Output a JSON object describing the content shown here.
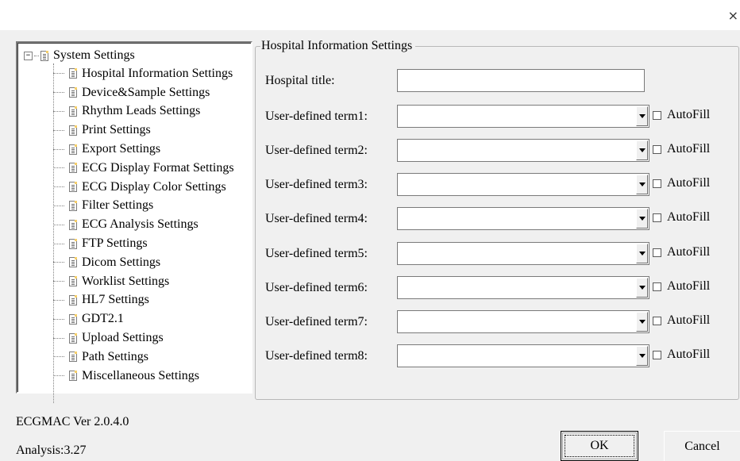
{
  "window": {
    "close_glyph": "×"
  },
  "tree": {
    "root_label": "System Settings",
    "expander_glyph": "−",
    "items": [
      "Hospital Information Settings",
      "Device&Sample Settings",
      "Rhythm Leads Settings",
      "Print Settings",
      "Export Settings",
      "ECG Display Format Settings",
      "ECG Display Color Settings",
      "Filter Settings",
      "ECG Analysis Settings",
      "FTP Settings",
      "Dicom Settings",
      "Worklist Settings",
      "HL7 Settings",
      "GDT2.1",
      "Upload Settings",
      "Path Settings",
      "Miscellaneous Settings"
    ]
  },
  "panel": {
    "title": "Hospital Information Settings",
    "hospital_title_label": "Hospital title:",
    "hospital_title_value": "",
    "autofill_label": "AutoFill",
    "terms": [
      {
        "label": "User-defined term1:",
        "value": "",
        "autofill": false
      },
      {
        "label": "User-defined term2:",
        "value": "",
        "autofill": false
      },
      {
        "label": "User-defined term3:",
        "value": "",
        "autofill": false
      },
      {
        "label": "User-defined term4:",
        "value": "",
        "autofill": false
      },
      {
        "label": "User-defined term5:",
        "value": "",
        "autofill": false
      },
      {
        "label": "User-defined term6:",
        "value": "",
        "autofill": false
      },
      {
        "label": "User-defined term7:",
        "value": "",
        "autofill": false
      },
      {
        "label": "User-defined term8:",
        "value": "",
        "autofill": false
      }
    ]
  },
  "footer": {
    "version": "ECGMAC Ver 2.0.4.0",
    "analysis": "Analysis:3.27",
    "ok_label": "OK",
    "cancel_label": "Cancel"
  }
}
